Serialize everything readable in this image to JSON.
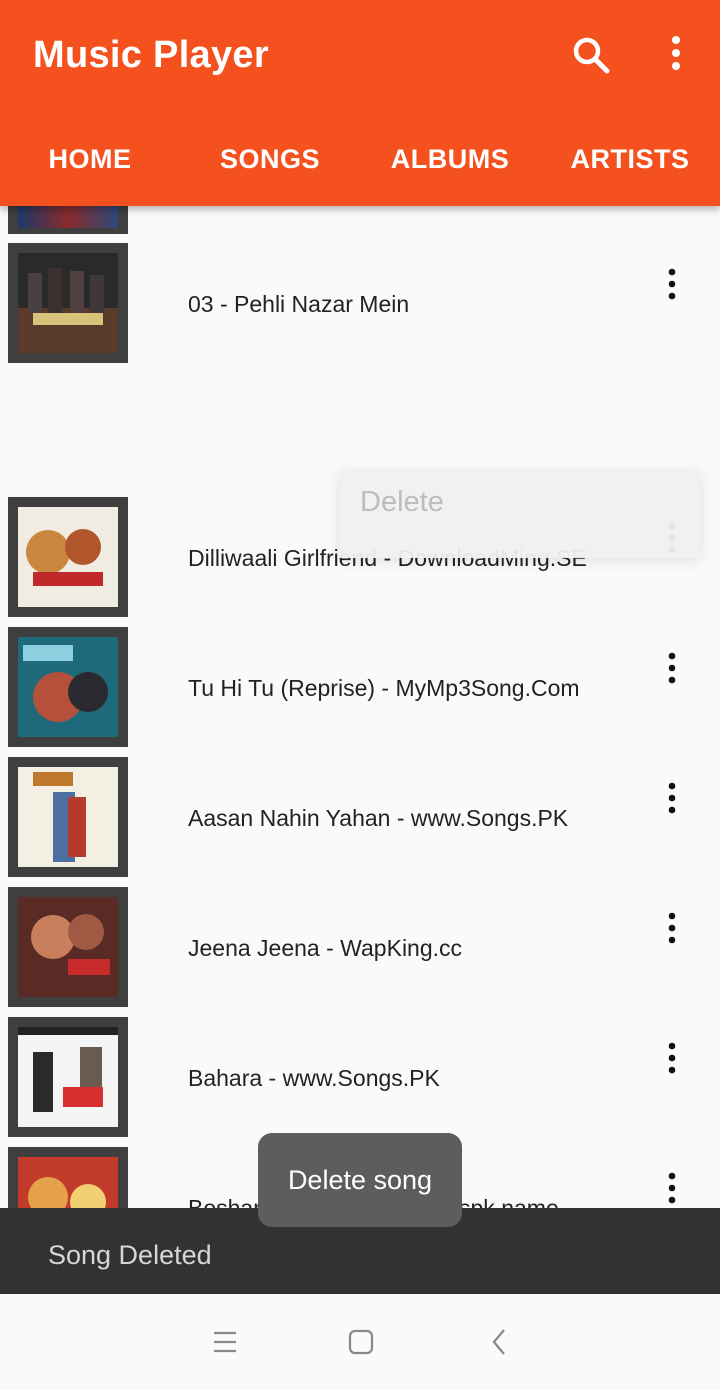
{
  "app_bar": {
    "title": "Music Player",
    "icons": [
      "search-icon",
      "more-vert-icon"
    ]
  },
  "tabs": [
    "HOME",
    "SONGS",
    "ALBUMS",
    "ARTISTS"
  ],
  "songs": [
    {
      "title": "03 - Pehli Nazar Mein"
    },
    {
      "title": "Dilliwaali Girlfriend - DownloadMing.SE"
    },
    {
      "title": "Tu Hi Tu (Reprise) - MyMp3Song.Com"
    },
    {
      "title": "Aasan Nahin Yahan - www.Songs.PK"
    },
    {
      "title": "Jeena Jeena - WapKing.cc"
    },
    {
      "title": "Bahara - www.Songs.PK"
    },
    {
      "title": "Besharmi Ki Height - Songspk.name"
    }
  ],
  "context_menu": {
    "item": "Delete"
  },
  "tooltip": {
    "text": "Delete song"
  },
  "snackbar": {
    "text": "Song Deleted"
  },
  "nav_bar": {
    "icons": [
      "recents-icon",
      "home-icon",
      "back-icon"
    ]
  },
  "colors": {
    "primary": "#f4511e",
    "snackbar": "#323232",
    "tooltip": "#5d5d5d"
  }
}
